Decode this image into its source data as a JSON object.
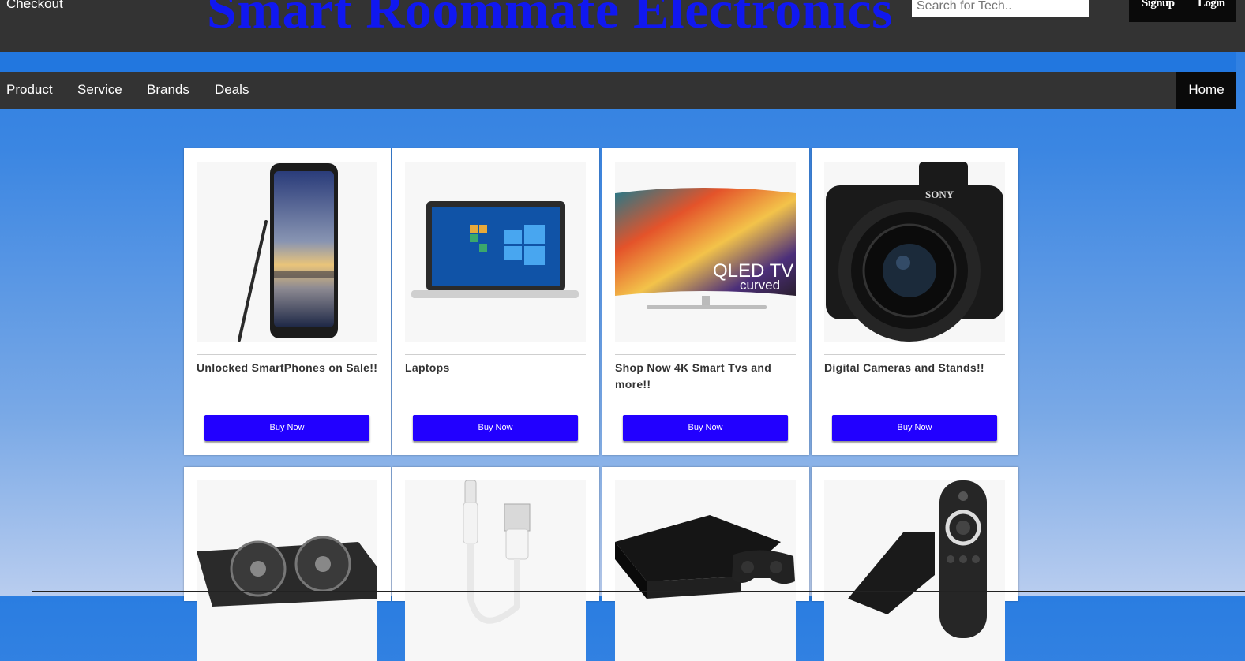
{
  "header": {
    "checkout": "Checkout",
    "title": "Smart Roommate Electronics",
    "search_placeholder": "Search for Tech..",
    "signup": "Signup",
    "login": "Login"
  },
  "nav": {
    "items": [
      "Product",
      "Service",
      "Brands",
      "Deals"
    ],
    "home": "Home"
  },
  "products": [
    {
      "caption": "Unlocked SmartPhones on Sale!!",
      "button": "Buy Now",
      "icon": "smartphone-image"
    },
    {
      "caption": "Laptops",
      "button": "Buy Now",
      "icon": "laptop-image"
    },
    {
      "caption": "Shop Now 4K Smart Tvs and more!!",
      "button": "Buy Now",
      "icon": "qled-tv-image",
      "tv_text_1": "QLED TV",
      "tv_text_2": "curved"
    },
    {
      "caption": "Digital Cameras and Stands!!",
      "button": "Buy Now",
      "icon": "camera-image",
      "brand": "SONY"
    },
    {
      "icon": "graphics-card-image"
    },
    {
      "icon": "usb-cable-image"
    },
    {
      "icon": "game-console-image"
    },
    {
      "icon": "streaming-remote-image"
    }
  ],
  "colors": {
    "header_bg": "#333333",
    "title": "#1018f0",
    "button": "#2200ff",
    "band": "#2277df"
  }
}
